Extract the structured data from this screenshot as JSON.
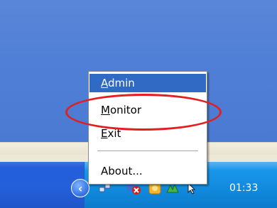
{
  "menu": {
    "items": [
      {
        "first": "A",
        "rest": "dmin"
      },
      {
        "first": "M",
        "rest": "onitor"
      },
      {
        "first": "E",
        "rest": "xit"
      },
      {
        "label": "About..."
      }
    ]
  },
  "tray": {
    "chevron": "‹",
    "clock": "01:33",
    "icons": [
      "network-icon",
      "alert-icon",
      "security-icon",
      "wireless-icon",
      "cursor-icon"
    ]
  },
  "colors": {
    "highlight": "#316ac5",
    "annotation": "#e31e1e",
    "taskbar": "#245edb",
    "tray": "#0f86d9"
  }
}
